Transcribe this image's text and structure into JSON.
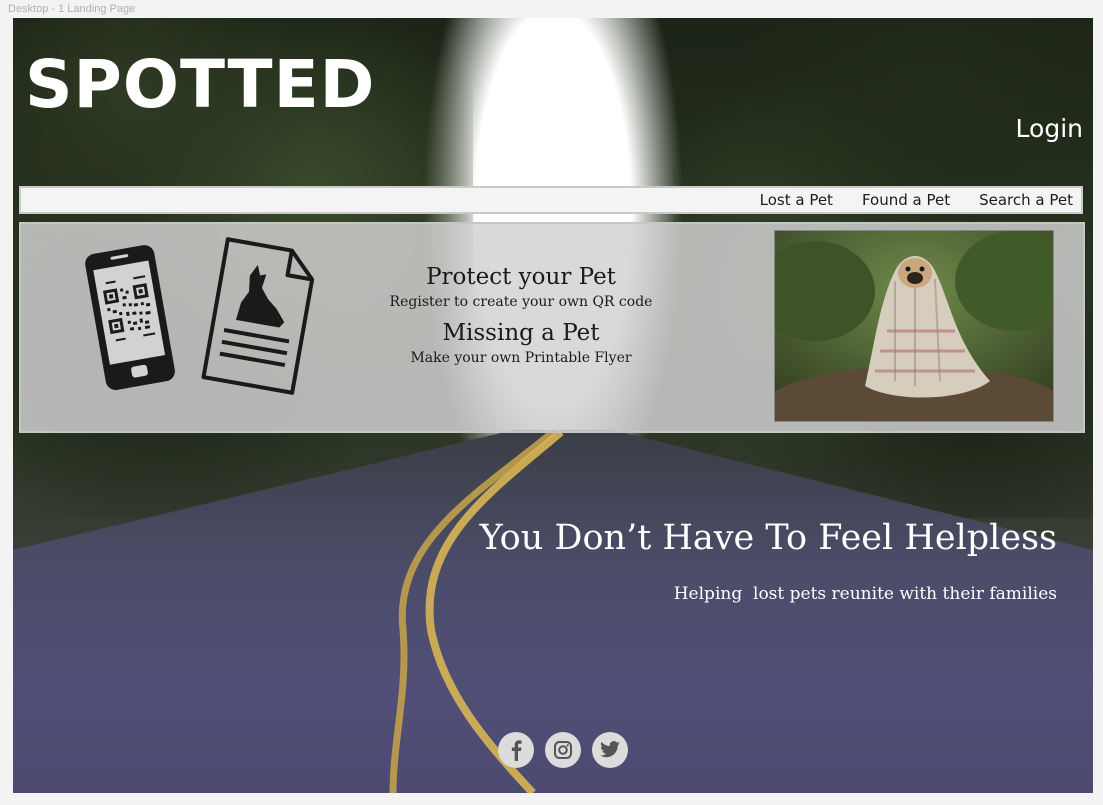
{
  "artboard": {
    "label": "Desktop - 1 Landing Page"
  },
  "header": {
    "logo_text": "SPOTTED",
    "login_label": "Login"
  },
  "nav": {
    "items": [
      {
        "label": "Lost a Pet"
      },
      {
        "label": "Found a Pet"
      },
      {
        "label": "Search a Pet"
      }
    ]
  },
  "info": {
    "protect_title": "Protect your Pet",
    "protect_text": "Register to create your own QR code",
    "missing_title": "Missing a Pet",
    "missing_text": "Make your own Printable Flyer"
  },
  "hero": {
    "title": "You Don’t Have To Feel Helpless",
    "subtitle": "Helping  lost pets reunite with their families"
  },
  "social": {
    "icons": [
      "facebook-icon",
      "instagram-icon",
      "twitter-icon"
    ]
  },
  "colors": {
    "text_light": "#ffffff",
    "nav_bg": "#f4f4f4",
    "panel_bg": "#d2d2d2",
    "social_circle": "#dcdcdc"
  }
}
